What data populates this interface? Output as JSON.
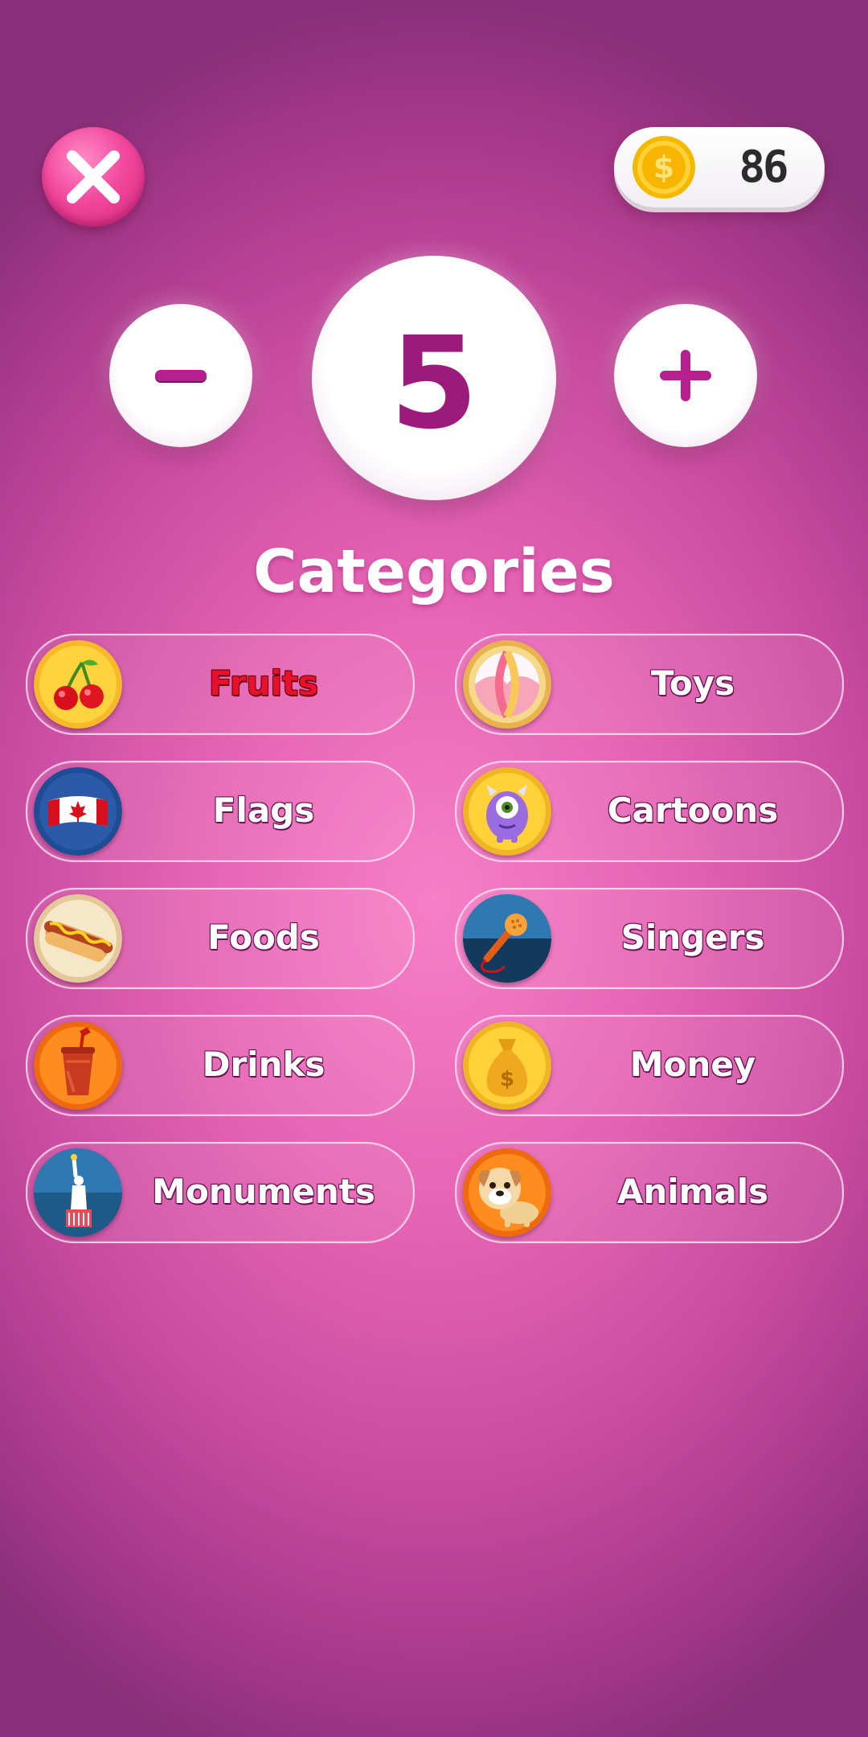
{
  "top_bar": {
    "close_icon": "close-x-icon",
    "coin_icon": "dollar-coin-icon",
    "coins": "86"
  },
  "stepper": {
    "minus_label": "−",
    "value": "5",
    "plus_label": "+"
  },
  "heading": "Categories",
  "categories": [
    {
      "label": "Fruits",
      "icon": "cherries-icon",
      "selected": true,
      "color": "#e8102a"
    },
    {
      "label": "Toys",
      "icon": "beach-ball-icon",
      "selected": false
    },
    {
      "label": "Flags",
      "icon": "canada-flag-icon",
      "selected": false
    },
    {
      "label": "Cartoons",
      "icon": "purple-monster-icon",
      "selected": false
    },
    {
      "label": "Foods",
      "icon": "hot-dog-icon",
      "selected": false
    },
    {
      "label": "Singers",
      "icon": "microphone-icon",
      "selected": false
    },
    {
      "label": "Drinks",
      "icon": "soda-cup-icon",
      "selected": false
    },
    {
      "label": "Money",
      "icon": "money-bag-icon",
      "selected": false
    },
    {
      "label": "Monuments",
      "icon": "statue-of-liberty-icon",
      "selected": false
    },
    {
      "label": "Animals",
      "icon": "dog-icon",
      "selected": false
    }
  ],
  "colors": {
    "background_center": "#f77fc6",
    "background_edge": "#8a2f79",
    "accent": "#9d1a7d",
    "close_button": "#f2489e",
    "selected_label": "#e8102a"
  }
}
